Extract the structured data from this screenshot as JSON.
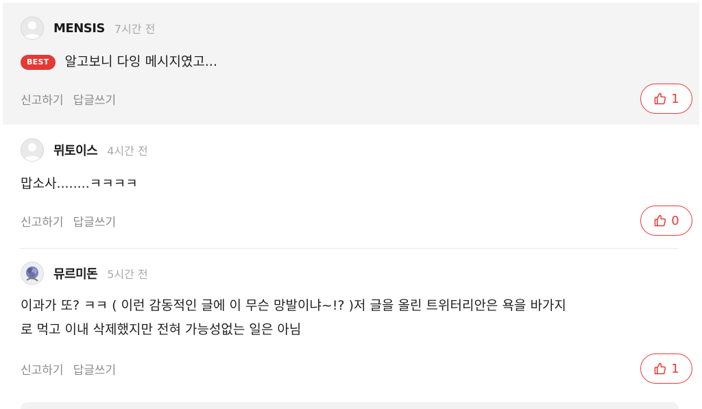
{
  "comments": [
    {
      "author": "MENSIS",
      "time": "7시간 전",
      "badge": "BEST",
      "text": "알고보니 다잉 메시지였고...",
      "report_label": "신고하기",
      "reply_label": "답글쓰기",
      "likes": "1"
    },
    {
      "author": "뮈토이스",
      "time": "4시간 전",
      "text": "맙소사........ㅋㅋㅋㅋ",
      "report_label": "신고하기",
      "reply_label": "답글쓰기",
      "likes": "0"
    },
    {
      "author": "뮤르미돈",
      "time": "5시간 전",
      "text_line1": "이과가 또? ㅋㅋ ( 이런 감동적인 글에 이 무슨 망발이냐~!? )저 글을 올린 트위터리안은 욕을 바가지",
      "text_line2": "로 먹고 이내 삭제했지만 전혀 가능성없는 일은 아님",
      "report_label": "신고하기",
      "reply_label": "답글쓰기",
      "likes": "1"
    }
  ],
  "colors": {
    "accent": "#e53935",
    "best_background": "#f4f4f4",
    "muted_text": "#8a8a8a"
  },
  "icons": {
    "avatar_default": "person-silhouette-icon",
    "avatar_custom": "blue-rose-avatar",
    "like": "thumbs-up-icon"
  }
}
